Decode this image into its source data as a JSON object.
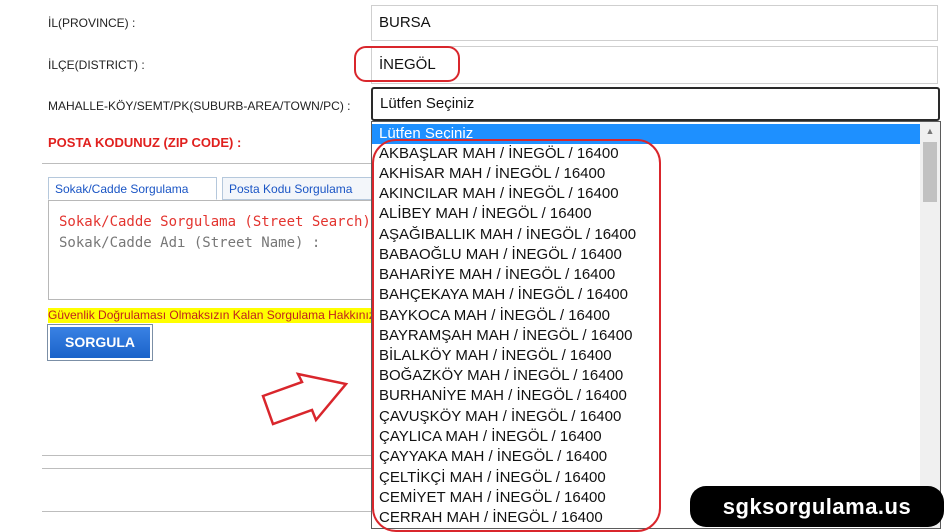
{
  "form": {
    "province_label": "İL(PROVINCE) :",
    "province_value": "BURSA",
    "district_label": "İLÇE(DISTRICT) :",
    "district_value": "İNEGÖL",
    "suburb_label": "MAHALLE-KÖY/SEMT/PK(SUBURB-AREA/TOWN/PC) :",
    "suburb_selected": "Lütfen Seçiniz",
    "zip_label": "POSTA KODUNUZ (ZIP CODE) :"
  },
  "tabs": [
    {
      "label": "Sokak/Cadde Sorgulama",
      "active": true
    },
    {
      "label": "Posta Kodu Sorgulama",
      "active": false
    }
  ],
  "street_search": {
    "title": "Sokak/Cadde Sorgulama (Street Search)",
    "street_name_label": "Sokak/Cadde Adı (Street Name) :"
  },
  "warning_text": "Güvenlik Doğrulaması Olmaksızın Kalan Sorgulama Hakkınız",
  "query_button": "SORGULA",
  "dropdown_options": [
    "Lütfen Seçiniz",
    "AKBAŞLAR MAH / İNEGÖL / 16400",
    "AKHİSAR MAH / İNEGÖL / 16400",
    "AKINCILAR MAH / İNEGÖL / 16400",
    "ALİBEY MAH / İNEGÖL / 16400",
    "AŞAĞIBALLIK MAH / İNEGÖL / 16400",
    "BABAOĞLU MAH / İNEGÖL / 16400",
    "BAHARİYE MAH / İNEGÖL / 16400",
    "BAHÇEKAYA MAH / İNEGÖL / 16400",
    "BAYKOCA MAH / İNEGÖL / 16400",
    "BAYRAMŞAH MAH / İNEGÖL / 16400",
    "BİLALKÖY MAH / İNEGÖL / 16400",
    "BOĞAZKÖY MAH / İNEGÖL / 16400",
    "BURHANİYE MAH / İNEGÖL / 16400",
    "ÇAVUŞKÖY MAH / İNEGÖL / 16400",
    "ÇAYLICA MAH / İNEGÖL / 16400",
    "ÇAYYAKA MAH / İNEGÖL / 16400",
    "ÇELTİKÇİ MAH / İNEGÖL / 16400",
    "CEMİYET MAH / İNEGÖL / 16400",
    "CERRAH MAH / İNEGÖL / 16400"
  ],
  "watermark": "sgksorgulama.us",
  "colors": {
    "highlight_red": "#d9262c",
    "selected_option": "#1e90ff",
    "button_blue": "#1a63c9",
    "warning_bg": "#ffff00"
  },
  "icons": {
    "scroll_up": "scroll-up-arrow-icon",
    "scroll_down": "scroll-down-arrow-icon",
    "pointer_arrow": "outline-arrow-icon"
  }
}
